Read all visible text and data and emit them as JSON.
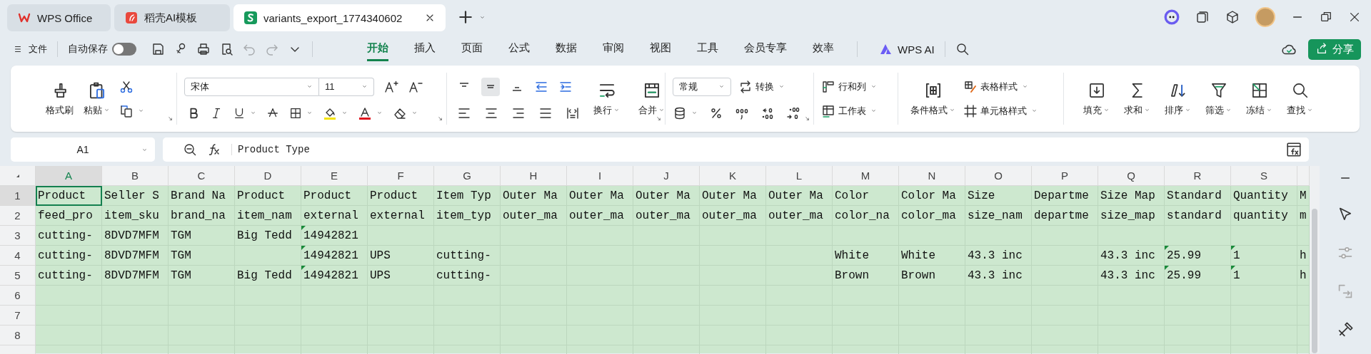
{
  "app_tabs": [
    {
      "label": "WPS Office",
      "kind": "wps",
      "selected": false
    },
    {
      "label": "稻壳AI模板",
      "kind": "docer",
      "selected": false
    },
    {
      "label": "variants_export_1774340602",
      "kind": "sheet",
      "selected": true
    }
  ],
  "menu": {
    "file": "文件",
    "autosave": {
      "label": "自动保存",
      "on": false
    },
    "undo": {
      "disabled": true
    },
    "redo": {
      "disabled": true
    }
  },
  "ribbon_tabs": [
    {
      "label": "开始",
      "selected": true
    },
    {
      "label": "插入",
      "selected": false
    },
    {
      "label": "页面",
      "selected": false
    },
    {
      "label": "公式",
      "selected": false
    },
    {
      "label": "数据",
      "selected": false
    },
    {
      "label": "审阅",
      "selected": false
    },
    {
      "label": "视图",
      "selected": false
    },
    {
      "label": "工具",
      "selected": false
    },
    {
      "label": "会员专享",
      "selected": false
    },
    {
      "label": "效率",
      "selected": false
    }
  ],
  "ai_tab": "WPS AI",
  "share": "分享",
  "ribbon": {
    "clipboard": {
      "format_painter": "格式刷",
      "paste": "粘贴"
    },
    "font": {
      "family": "宋体",
      "size": "11"
    },
    "alignment": {
      "vertical": [
        {
          "selected": false
        },
        {
          "selected": true
        },
        {
          "selected": false
        }
      ],
      "wrap": "换行",
      "merge": "合并"
    },
    "number": {
      "format": "常规",
      "convert": "转换"
    },
    "cells": {
      "rows_cols": "行和列",
      "worksheet": "工作表"
    },
    "styles": {
      "conditional": "条件格式",
      "table_style": "表格样式",
      "cell_style": "单元格样式"
    },
    "editing": [
      "填充",
      "求和",
      "排序",
      "筛选",
      "冻结",
      "查找"
    ]
  },
  "formula_bar": {
    "name_box": "A1",
    "formula": "Product Type"
  },
  "grid": {
    "columns": [
      {
        "label": "A",
        "selected": true
      },
      {
        "label": "B",
        "selected": false
      },
      {
        "label": "C",
        "selected": false
      },
      {
        "label": "D",
        "selected": false
      },
      {
        "label": "E",
        "selected": false
      },
      {
        "label": "F",
        "selected": false
      },
      {
        "label": "G",
        "selected": false
      },
      {
        "label": "H",
        "selected": false
      },
      {
        "label": "I",
        "selected": false
      },
      {
        "label": "J",
        "selected": false
      },
      {
        "label": "K",
        "selected": false
      },
      {
        "label": "L",
        "selected": false
      },
      {
        "label": "M",
        "selected": false
      },
      {
        "label": "N",
        "selected": false
      },
      {
        "label": "O",
        "selected": false
      },
      {
        "label": "P",
        "selected": false
      },
      {
        "label": "Q",
        "selected": false
      },
      {
        "label": "R",
        "selected": false
      },
      {
        "label": "S",
        "selected": false
      }
    ],
    "rows": [
      {
        "label": "1",
        "selected": true,
        "cells": [
          "Product",
          "Seller S",
          "Brand Na",
          "Product",
          "Product",
          "Product",
          "Item Typ",
          "Outer Ma",
          "Outer Ma",
          "Outer Ma",
          "Outer Ma",
          "Outer Ma",
          "Color",
          "Color Ma",
          "Size",
          "Departme",
          "Size Map",
          "Standard",
          "Quantity",
          "M"
        ],
        "flagged": [
          false,
          false,
          false,
          false,
          false,
          false,
          false,
          false,
          false,
          false,
          false,
          false,
          false,
          false,
          false,
          false,
          false,
          false,
          false,
          false
        ]
      },
      {
        "label": "2",
        "selected": false,
        "cells": [
          "feed_pro",
          "item_sku",
          "brand_na",
          "item_nam",
          "external",
          "external",
          "item_typ",
          "outer_ma",
          "outer_ma",
          "outer_ma",
          "outer_ma",
          "outer_ma",
          "color_na",
          "color_ma",
          "size_nam",
          "departme",
          "size_map",
          "standard",
          "quantity",
          "m"
        ],
        "flagged": [
          false,
          false,
          false,
          false,
          false,
          false,
          false,
          false,
          false,
          false,
          false,
          false,
          false,
          false,
          false,
          false,
          false,
          false,
          false,
          false
        ]
      },
      {
        "label": "3",
        "selected": false,
        "cells": [
          "cutting-",
          "8DVD7MFM",
          "TGM",
          "Big Tedd",
          "14942821",
          null,
          null,
          null,
          null,
          null,
          null,
          null,
          null,
          null,
          null,
          null,
          null,
          null,
          null,
          null
        ],
        "flagged": [
          false,
          false,
          false,
          false,
          true,
          false,
          false,
          false,
          false,
          false,
          false,
          false,
          false,
          false,
          false,
          false,
          false,
          false,
          false,
          false
        ]
      },
      {
        "label": "4",
        "selected": false,
        "cells": [
          "cutting-",
          "8DVD7MFM",
          "TGM",
          null,
          "14942821",
          "UPS",
          "cutting-",
          null,
          null,
          null,
          null,
          null,
          "White",
          "White",
          "43.3 inc",
          null,
          "43.3 inc",
          "25.99",
          "1",
          "h"
        ],
        "flagged": [
          false,
          false,
          false,
          false,
          true,
          false,
          false,
          false,
          false,
          false,
          false,
          false,
          false,
          false,
          false,
          false,
          false,
          true,
          true,
          false
        ]
      },
      {
        "label": "5",
        "selected": false,
        "cells": [
          "cutting-",
          "8DVD7MFM",
          "TGM",
          "Big Tedd",
          "14942821",
          "UPS",
          "cutting-",
          null,
          null,
          null,
          null,
          null,
          "Brown",
          "Brown",
          "43.3 inc",
          null,
          "43.3 inc",
          "25.99",
          "1",
          "h"
        ],
        "flagged": [
          false,
          false,
          false,
          false,
          true,
          false,
          false,
          false,
          false,
          false,
          false,
          false,
          false,
          false,
          false,
          false,
          false,
          true,
          true,
          false
        ]
      },
      {
        "label": "6",
        "selected": false
      },
      {
        "label": "7",
        "selected": false
      },
      {
        "label": "8",
        "selected": false
      }
    ]
  }
}
